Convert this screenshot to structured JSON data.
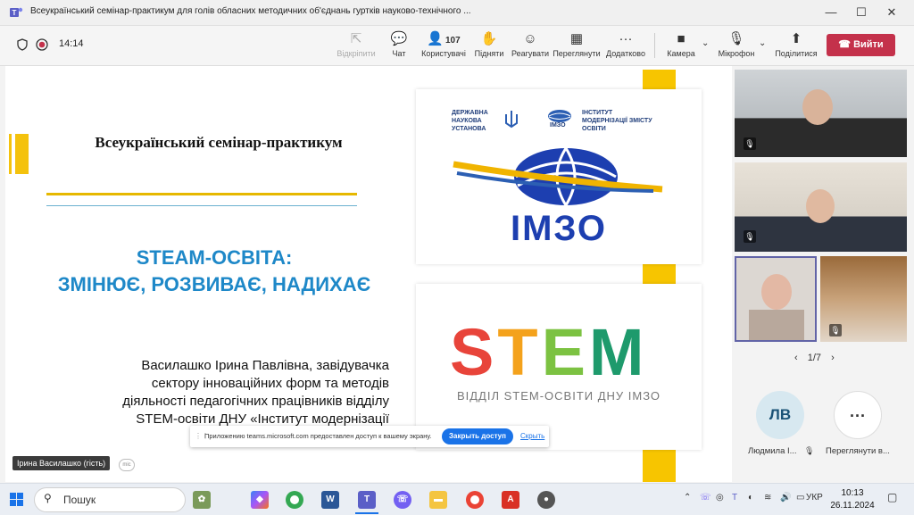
{
  "window": {
    "title": "Всеукраїнський семінар-практикум для голів обласних методичних об'єднань гуртків науково-технічного ...",
    "min": "—",
    "max": "☐",
    "close": "✕"
  },
  "meeting": {
    "timer": "14:14",
    "toolbar": [
      {
        "label": "Відкріпити",
        "icon": "unpin-icon",
        "glyph": "⇱"
      },
      {
        "label": "Чат",
        "icon": "chat-icon",
        "glyph": "💬"
      },
      {
        "label": "Користувачі",
        "icon": "people-icon",
        "glyph": "👤"
      },
      {
        "label": "Підняти",
        "icon": "raise-hand-icon",
        "glyph": "✋"
      },
      {
        "label": "Реагувати",
        "icon": "react-icon",
        "glyph": "☺"
      },
      {
        "label": "Переглянути",
        "icon": "view-icon",
        "glyph": "▦"
      },
      {
        "label": "Додатково",
        "icon": "more-icon",
        "glyph": "···"
      },
      {
        "label": "Камера",
        "icon": "camera-icon",
        "glyph": "■"
      },
      {
        "label": "Мікрофон",
        "icon": "mic-off-icon",
        "glyph": "🎙"
      },
      {
        "label": "Поділитися",
        "icon": "share-icon",
        "glyph": "⬆"
      }
    ],
    "participants_count": "107",
    "leave_label": "Вийти"
  },
  "slide": {
    "title": "Всеукраїнський семінар-практикум",
    "headline1": "STEAM-ОСВІТА:",
    "headline2": "ЗМІНЮЄ, РОЗВИВАЄ, НАДИХАЄ",
    "author": [
      "Василашко Ірина Павлівна, завідувачка",
      "сектору інноваційних форм та методів",
      "діяльності педагогічних працівників відділу",
      "STEM-освіти ДНУ «Інститут модернізації"
    ],
    "logo1": {
      "dns": [
        "ДЕРЖАВНА",
        "НАУКОВА",
        "УСТАНОВА"
      ],
      "inst": [
        "ІНСТИТУТ",
        "МОДЕРНІЗАЦІЇ ЗМІСТУ",
        "ОСВІТИ"
      ],
      "small": "ІМЗО",
      "big": "ІМЗО"
    },
    "logo2": {
      "letters": [
        "S",
        "T",
        "E",
        "M"
      ],
      "subtitle": "ВІДДІЛ STEM-ОСВІТИ ДНУ ІМЗО"
    }
  },
  "share_banner": {
    "text": "Приложению teams.microsoft.com предоставлен доступ к вашему экрану.",
    "button": "Закрыть доступ",
    "link": "Скрыть"
  },
  "speaker": {
    "name": "Ірина Василашко (гість)"
  },
  "gallery": {
    "pager": "1/7",
    "avatars": [
      {
        "initials": "ЛВ",
        "name": "Людмила І..."
      },
      {
        "initials": "···",
        "name": "Переглянути в..."
      }
    ]
  },
  "taskbar": {
    "search_label": "Пошук",
    "lang": "УКР",
    "time": "10:13",
    "date": "26.11.2024"
  },
  "colors": {
    "accent_yellow": "#f7c500",
    "steam_blue": "#1e88c8",
    "leave_red": "#c4314b",
    "imzo_blue": "#1d3fb0"
  }
}
